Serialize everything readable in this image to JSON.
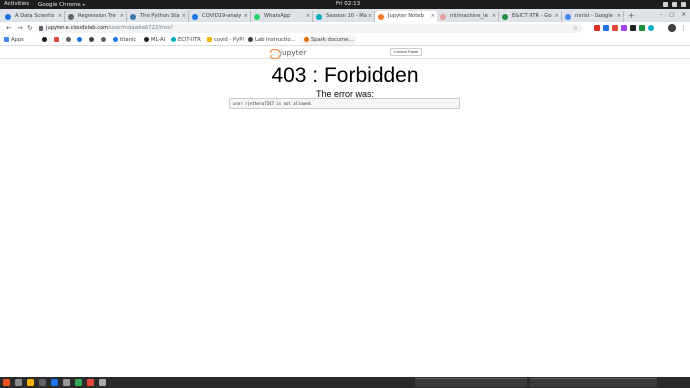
{
  "system_bar": {
    "activities": "Activities",
    "app_name": "Google Chrome",
    "clock": "Fri 02:13"
  },
  "tabs": [
    {
      "label": "A Data Scientis",
      "favicon_color": "#1a73e8"
    },
    {
      "label": "Regression Tre",
      "favicon_color": "#5f6368"
    },
    {
      "label": "The Python Sta",
      "favicon_color": "#3776ab"
    },
    {
      "label": "COVID19-analy",
      "favicon_color": "#1a73e8"
    },
    {
      "label": "WhatsApp",
      "favicon_color": "#25d366"
    },
    {
      "label": "Session 10 - Ma",
      "favicon_color": "#00acc1"
    },
    {
      "label": "Jupyter Noteb",
      "favicon_color": "#f37726"
    },
    {
      "label": "ml/machine_le",
      "favicon_color": "#e8a0a0"
    },
    {
      "label": "E&ICT IITR - Go",
      "favicon_color": "#1e8e3e"
    },
    {
      "label": "mnist - Google",
      "favicon_color": "#4285f4"
    }
  ],
  "address_bar": {
    "host": "jupyter.e.cloudxlab.com",
    "path": "/user/mdawka6722/tree?"
  },
  "bookmarks": [
    {
      "label": "Apps",
      "color": "#4285f4"
    },
    {
      "label": "",
      "color": "#111111"
    },
    {
      "label": "",
      "color": "#e8453c"
    },
    {
      "label": "",
      "color": "#5f6368"
    },
    {
      "label": "",
      "color": "#1a73e8"
    },
    {
      "label": "",
      "color": "#3c4043"
    },
    {
      "label": "",
      "color": "#5f6368"
    },
    {
      "label": "titanic",
      "color": "#1a73e8"
    },
    {
      "label": "ML-AI",
      "color": "#222222"
    },
    {
      "label": "ECIT-IITR",
      "color": "#00acc1"
    },
    {
      "label": "covid - PyPI",
      "color": "#f4b400"
    },
    {
      "label": "Lab Instructio...",
      "color": "#3c4043"
    },
    {
      "label": "Spark docume...",
      "color": "#e8710a"
    }
  ],
  "jupyter": {
    "logo_text": "jupyter",
    "control_panel_label": "Control Panel",
    "error_title": "403 : Forbidden",
    "error_subtitle": "The error was:",
    "error_message": "user rjethera7547 is not allowed."
  }
}
